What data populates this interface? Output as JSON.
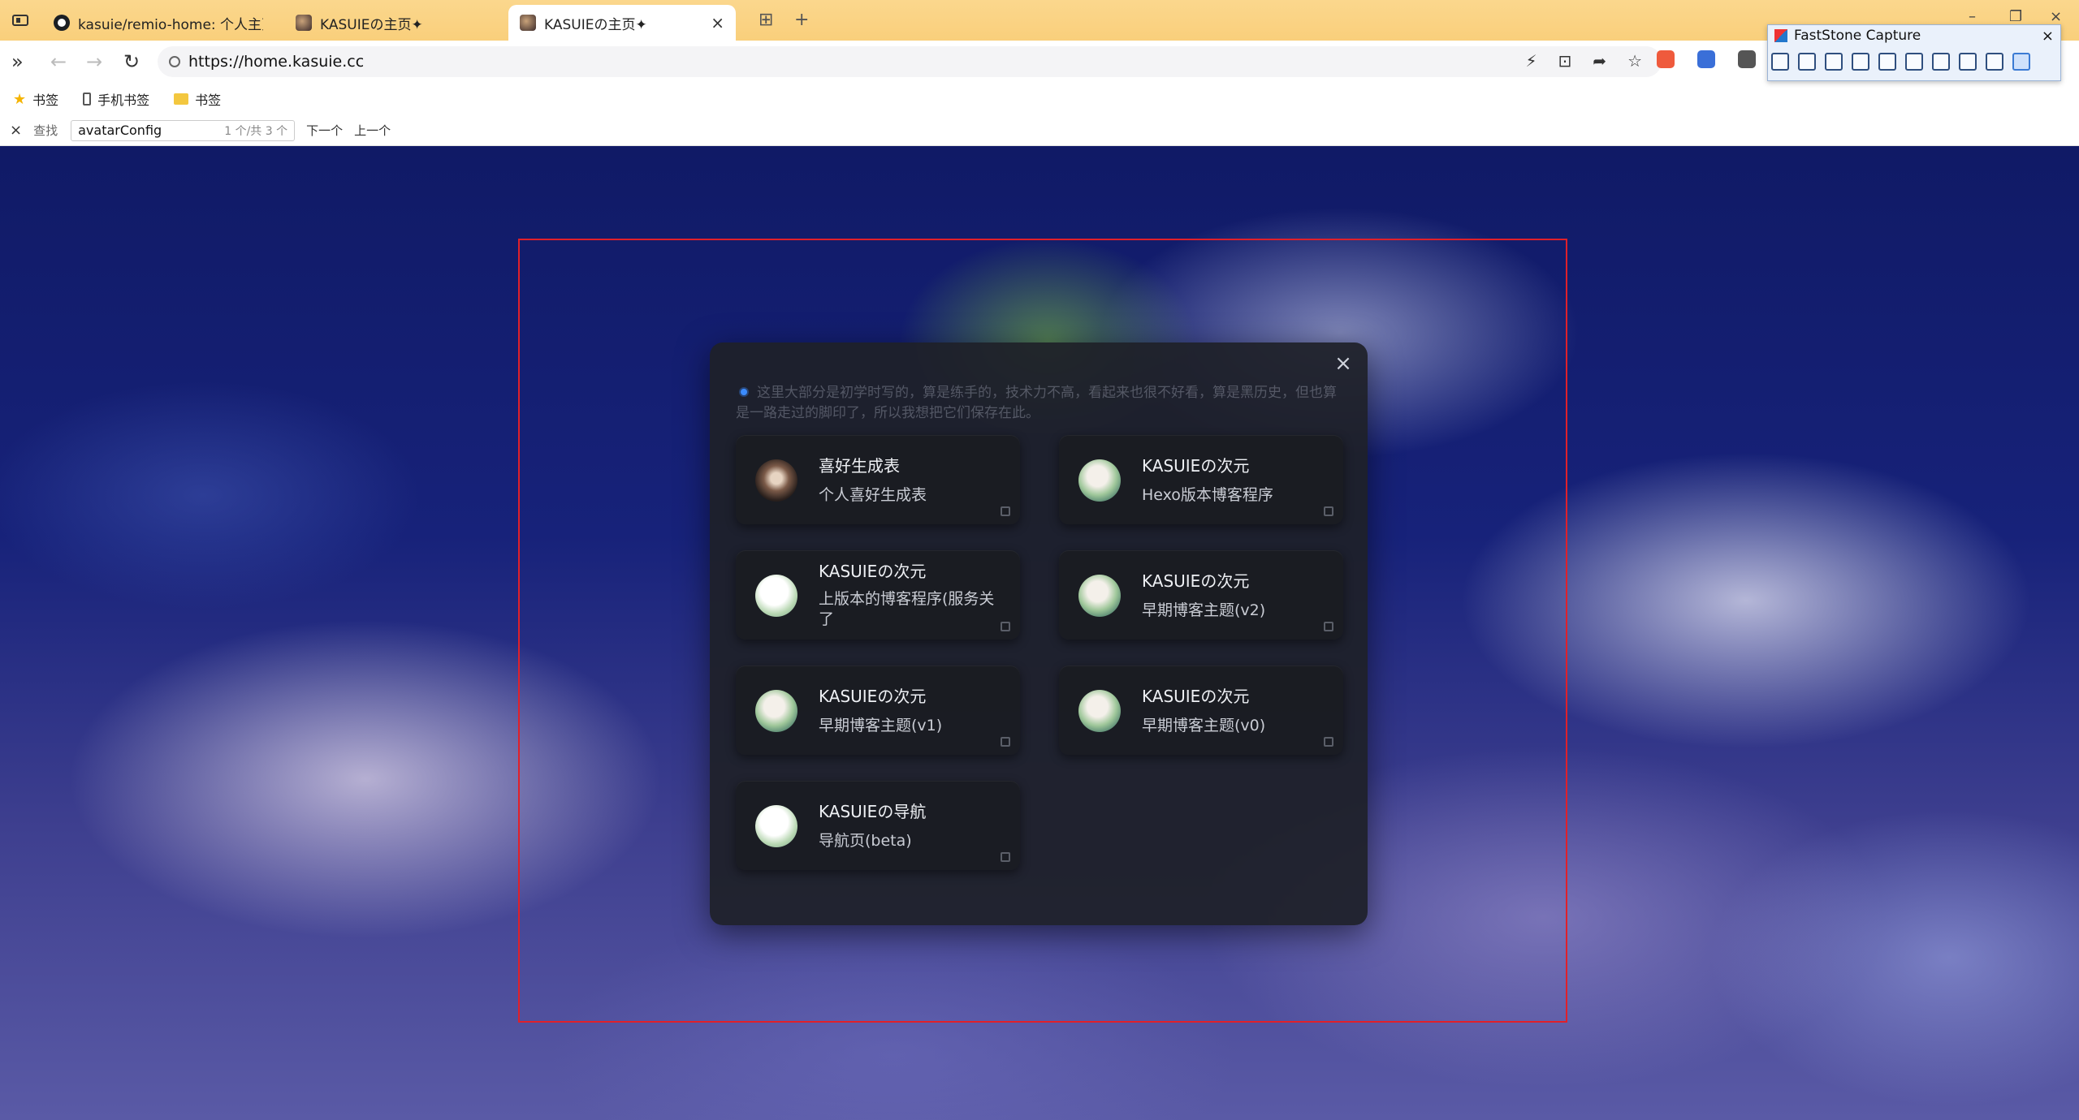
{
  "tabs": [
    {
      "title": "kasuie/remio-home: 个人主页/h",
      "icon": "github-icon",
      "active": false
    },
    {
      "title": "KASUIEの主页✦",
      "icon": "site-favicon",
      "active": false
    },
    {
      "title": "KASUIEの主页✦",
      "icon": "site-favicon",
      "active": true,
      "close": "×"
    }
  ],
  "tab_actions": {
    "split": "⊞",
    "new_tab": "+"
  },
  "window_controls": {
    "minimize": "–",
    "restore": "❐",
    "close": "×"
  },
  "address_bar": {
    "url": "https://home.kasuie.cc"
  },
  "toolbar": {
    "sidebar_toggle": "»",
    "back": "←",
    "forward": "→",
    "reload": "↻"
  },
  "url_actions": [
    "⚡",
    "⊡",
    "➦",
    "☆"
  ],
  "bookmarks": [
    {
      "label": "书签",
      "icon": "star-icon"
    },
    {
      "label": "手机书签",
      "icon": "phone-icon"
    },
    {
      "label": "书签",
      "icon": "folder-icon"
    }
  ],
  "find_bar": {
    "close": "×",
    "label": "查找",
    "query": "avatarConfig",
    "count": "1 个/共 3 个",
    "next": "下一个",
    "prev": "上一个"
  },
  "modal": {
    "close": "×",
    "notice": "这里大部分是初学时写的，算是练手的，技术力不高，看起来也很不好看，算是黑历史，但也算是一路走过的脚印了，所以我想把它们保存在此。",
    "cards": [
      {
        "name": "喜好生成表",
        "desc": "个人喜好生成表",
        "avatar": "dark"
      },
      {
        "name": "KASUIEの次元",
        "desc": "Hexo版本博客程序",
        "avatar": "green"
      },
      {
        "name": "KASUIEの次元",
        "desc": "上版本的博客程序(服务关了",
        "avatar": "light"
      },
      {
        "name": "KASUIEの次元",
        "desc": "早期博客主题(v2)",
        "avatar": "green"
      },
      {
        "name": "KASUIEの次元",
        "desc": "早期博客主题(v1)",
        "avatar": "green"
      },
      {
        "name": "KASUIEの次元",
        "desc": "早期博客主题(v0)",
        "avatar": "green"
      },
      {
        "name": "KASUIEの导航",
        "desc": "导航页(beta)",
        "avatar": "light"
      }
    ]
  },
  "faststone": {
    "title": "FastStone Capture",
    "close": "×"
  },
  "colors": {
    "tabbar": "#f9cf7b",
    "modal_bg": "#1e2028",
    "selection_border": "#e0202a",
    "accent_dot": "#3b8cff"
  }
}
